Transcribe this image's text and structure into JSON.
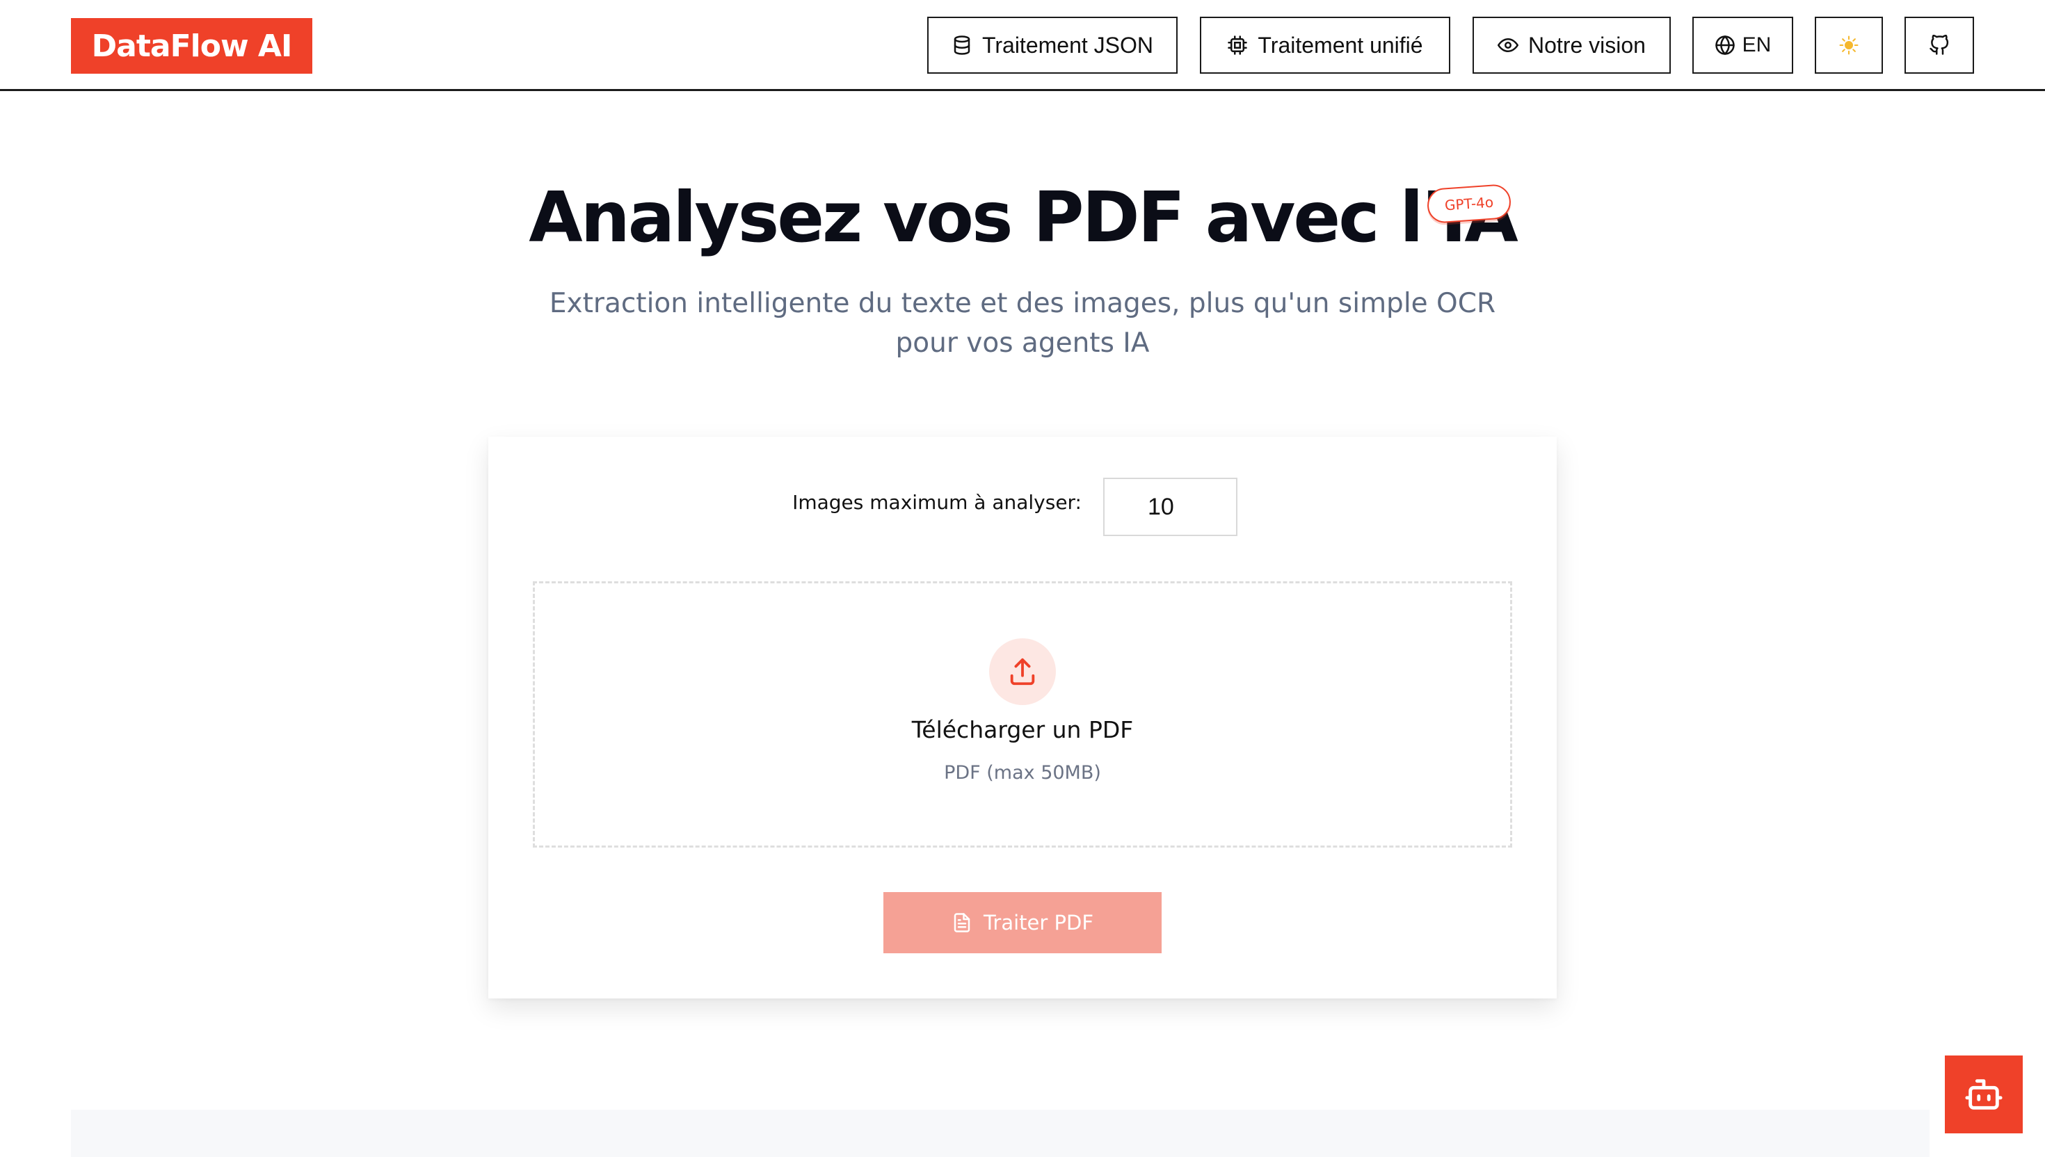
{
  "header": {
    "logo": "DataFlow AI",
    "nav": {
      "json_label": "Traitement JSON",
      "unified_label": "Traitement unifié",
      "vision_label": "Notre vision",
      "lang_label": "EN",
      "theme_icon": "sun-icon",
      "github_icon": "github-icon"
    }
  },
  "hero": {
    "title": "Analysez vos PDF avec l'IA",
    "badge": "GPT-4o",
    "subtitle_line1": "Extraction intelligente du texte et des images, plus qu'un simple OCR",
    "subtitle_line2": "pour vos agents IA"
  },
  "form": {
    "images_label": "Images maximum à analyser:",
    "images_value": "10",
    "dropzone_title": "Télécharger un PDF",
    "dropzone_subtitle": "PDF (max 50MB)",
    "process_label": "Traiter PDF"
  },
  "colors": {
    "accent": "#ef4129",
    "accent_light": "#f5a195",
    "muted_text": "#5f6b81"
  }
}
